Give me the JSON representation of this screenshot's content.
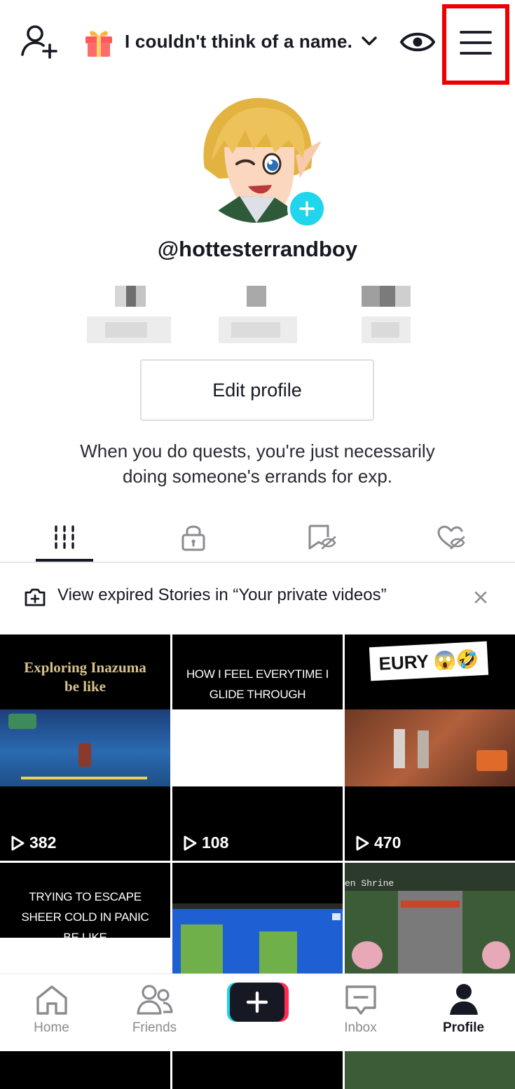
{
  "header": {
    "account_name": "I couldn't think of a name."
  },
  "profile": {
    "username": "@hottesterrandboy",
    "edit_profile_label": "Edit profile",
    "bio_line1": "When you do quests, you're just necessarily",
    "bio_line2": "doing someone's errands for exp."
  },
  "tabs": [
    {
      "icon": "grid-icon",
      "active": true
    },
    {
      "icon": "lock-icon",
      "active": false
    },
    {
      "icon": "hidden-bookmark-icon",
      "active": false
    },
    {
      "icon": "hidden-heart-icon",
      "active": false
    }
  ],
  "stories_banner": {
    "text": "View expired Stories in “Your private videos”"
  },
  "videos": [
    {
      "caption": "Exploring Inazuma be like",
      "plays": "382"
    },
    {
      "caption": "HOW I FEEL EVERYTIME I GLIDE THROUGH MONDSTAT",
      "plays": "108"
    },
    {
      "caption": "EURY 😱🤣",
      "plays": "470"
    },
    {
      "caption": "TRYING TO ESCAPE SHEER COLD IN PANIC BE LIKE",
      "plays": ""
    },
    {
      "caption": "",
      "plays": ""
    },
    {
      "caption": "en Shrine",
      "plays": ""
    }
  ],
  "nav": {
    "home": "Home",
    "friends": "Friends",
    "inbox": "Inbox",
    "profile": "Profile"
  },
  "colors": {
    "accent_cyan": "#20d5ec",
    "accent_red": "#fe2c55",
    "highlight": "#ee0000"
  }
}
